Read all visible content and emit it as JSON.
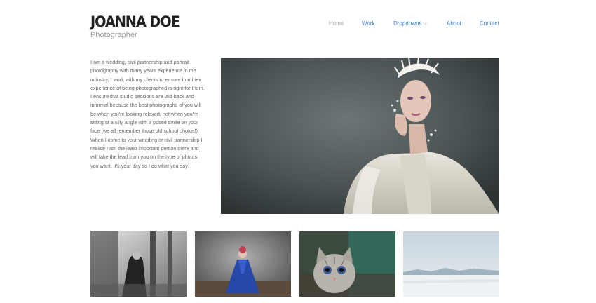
{
  "brand": {
    "title": "JOANNA DOE",
    "subtitle": "Photographer"
  },
  "nav": {
    "items": [
      {
        "label": "Home",
        "state": "current"
      },
      {
        "label": "Work"
      },
      {
        "label": "Dropdowns",
        "has_dropdown": true
      },
      {
        "label": "About"
      },
      {
        "label": "Contact"
      }
    ],
    "colors": {
      "link": "#3a7bc8",
      "current": "#aaaaaa"
    }
  },
  "intro": {
    "text": "I am a wedding, civil partnership and portrait photography with many years experience in the industry. I work with my clients to ensure that their experience of being photographed is right for them. I ensure that studio sessions are laid back and informal because the best photographs of you will be when you're looking relaxed, not when you're sitting at a silly angle with a posed smile on your face (we all remember those old school photos!). When I come to your wedding or civil partnership I realise I am the least important person there and I will take the lead from you on the type of photos you want. It's your day so I do what you say."
  },
  "hero_image": {
    "subject": "woman in white gown with feathered headpiece"
  },
  "thumbnails": [
    {
      "subject": "black and white woman in forest"
    },
    {
      "subject": "woman in blue gown in studio"
    },
    {
      "subject": "kitten portrait"
    },
    {
      "subject": "snowy winter landscape"
    }
  ]
}
